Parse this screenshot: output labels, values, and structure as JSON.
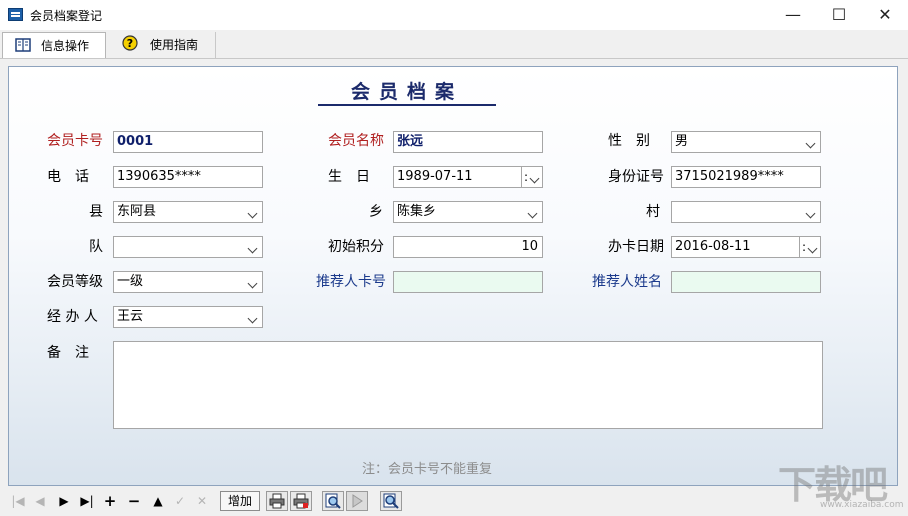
{
  "window": {
    "title": "会员档案登记",
    "minimize": "—",
    "maximize": "☐",
    "close": "✕"
  },
  "tabs": [
    {
      "label": "信息操作",
      "icon": "book-icon"
    },
    {
      "label": "使用指南",
      "icon": "help-icon"
    }
  ],
  "form": {
    "title": "会员档案",
    "card_no": {
      "label": "会员卡号",
      "value": "0001"
    },
    "member_name": {
      "label": "会员名称",
      "value": "张远"
    },
    "gender": {
      "label": "性　别",
      "value": "男"
    },
    "phone": {
      "label": "电　话",
      "value": "1390635****"
    },
    "birthday": {
      "label": "生　日",
      "value": "1989-07-11"
    },
    "id_no": {
      "label": "身份证号",
      "value": "3715021989****"
    },
    "county": {
      "label": "县",
      "value": "东阿县"
    },
    "township": {
      "label": "乡",
      "value": "陈集乡"
    },
    "village": {
      "label": "村",
      "value": ""
    },
    "team": {
      "label": "队",
      "value": ""
    },
    "initial_points": {
      "label": "初始积分",
      "value": "10"
    },
    "card_date": {
      "label": "办卡日期",
      "value": "2016-08-11"
    },
    "level": {
      "label": "会员等级",
      "value": "一级"
    },
    "referrer_card": {
      "label": "推荐人卡号",
      "value": ""
    },
    "referrer_name": {
      "label": "推荐人姓名",
      "value": ""
    },
    "handler": {
      "label": "经 办 人",
      "value": "王云"
    },
    "remarks": {
      "label": "备　注",
      "value": ""
    },
    "note": "注：会员卡号不能重复"
  },
  "toolbar": {
    "first": "|◀",
    "prev": "◀",
    "next": "▶",
    "last": "▶|",
    "insert": "+",
    "delete": "−",
    "edit": "▲",
    "post": "✓",
    "cancel": "✕",
    "add_label": "增加"
  },
  "watermark": {
    "text": "下载吧",
    "url": "www.xiazaiba.com"
  },
  "colors": {
    "required_label": "#b02020",
    "link_label": "#1b3a8c",
    "title": "#1b2a6b",
    "referrer_field": "#eafaf0"
  }
}
